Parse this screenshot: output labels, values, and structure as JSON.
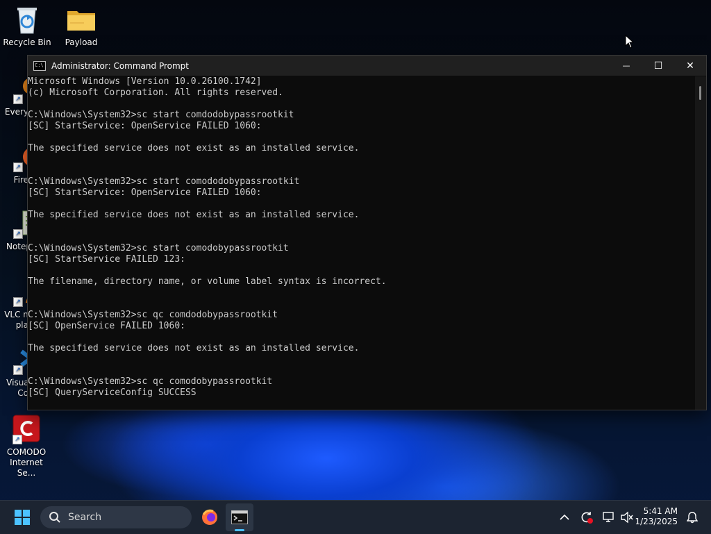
{
  "desktop": {
    "icons": [
      {
        "label": "Recycle Bin",
        "icon": "recycle-bin-icon"
      },
      {
        "label": "Payload",
        "icon": "folder-icon"
      },
      {
        "label": "Every",
        "icon": "everything-search-icon"
      },
      {
        "label": "Fire",
        "icon": "firefox-icon"
      },
      {
        "label": "Notep",
        "icon": "notepad-plus-plus-icon"
      },
      {
        "label": "VLC m",
        "label2": "pla",
        "icon": "vlc-icon"
      },
      {
        "label": "Visual",
        "label2": "Co",
        "icon": "vscode-icon"
      },
      {
        "label": "COMODO",
        "label2": "Internet Se...",
        "icon": "comodo-icon"
      }
    ]
  },
  "window": {
    "title": "Administrator: Command Prompt",
    "minimize": "—",
    "maximize": "☐",
    "close": "✕",
    "console_lines": [
      "Microsoft Windows [Version 10.0.26100.1742]",
      "(c) Microsoft Corporation. All rights reserved.",
      "",
      "C:\\Windows\\System32>sc start comdodobypassrootkit",
      "[SC] StartService: OpenService FAILED 1060:",
      "",
      "The specified service does not exist as an installed service.",
      "",
      "",
      "C:\\Windows\\System32>sc start comododobypassrootkit",
      "[SC] StartService: OpenService FAILED 1060:",
      "",
      "The specified service does not exist as an installed service.",
      "",
      "",
      "C:\\Windows\\System32>sc start comodobypassrootkit",
      "[SC] StartService FAILED 123:",
      "",
      "The filename, directory name, or volume label syntax is incorrect.",
      "",
      "",
      "C:\\Windows\\System32>sc qc comdodobypassrootkit",
      "[SC] OpenService FAILED 1060:",
      "",
      "The specified service does not exist as an installed service.",
      "",
      "",
      "C:\\Windows\\System32>sc qc comodobypassrootkit",
      "[SC] QueryServiceConfig SUCCESS"
    ]
  },
  "taskbar": {
    "search_placeholder": "Search",
    "time": "5:41 AM",
    "date": "1/23/2025"
  }
}
